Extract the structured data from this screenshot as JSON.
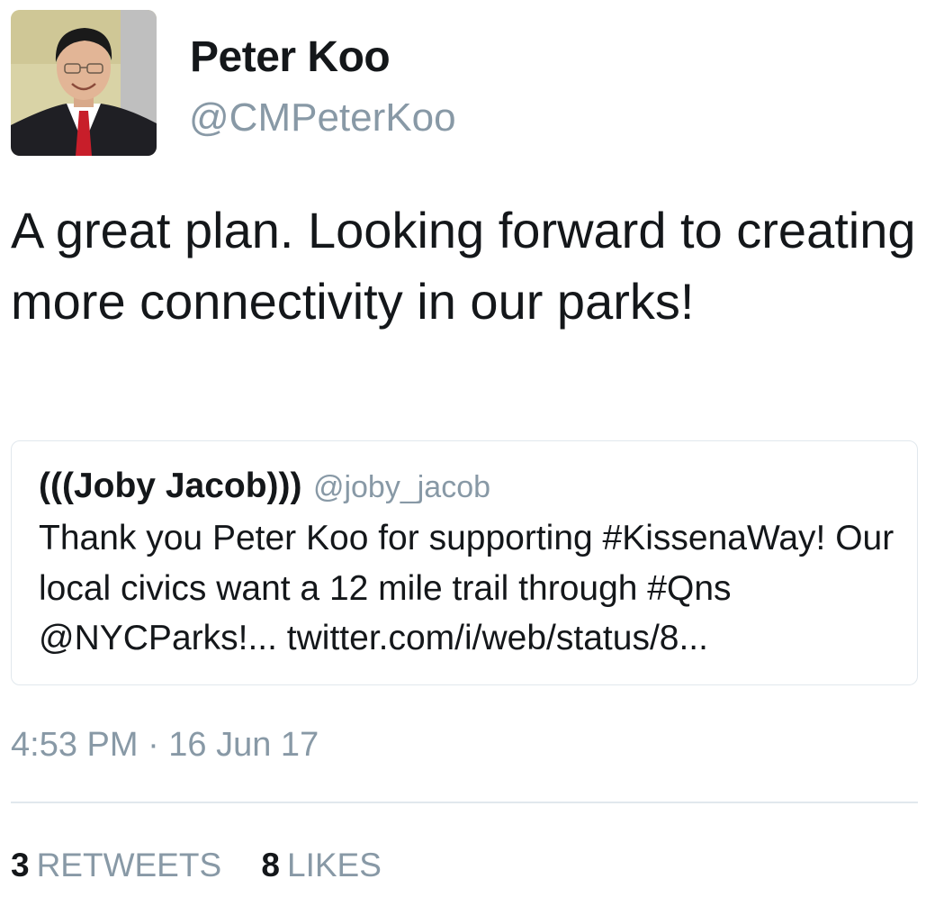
{
  "author": {
    "name": "Peter Koo",
    "handle": "@CMPeterKoo"
  },
  "tweet": {
    "text": "A great plan. Looking forward to creating more connectivity in our parks!"
  },
  "quoted_tweet": {
    "name": "(((Joby Jacob)))",
    "handle": "@joby_jacob",
    "text": "Thank you Peter Koo for supporting #KissenaWay! Our local civics want a 12 mile trail through #Qns @NYCParks!... twitter.com/i/web/status/8..."
  },
  "timestamp": "4:53 PM · 16 Jun 17",
  "stats": {
    "retweets_count": "3",
    "retweets_label": "RETWEETS",
    "likes_count": "8",
    "likes_label": "LIKES"
  },
  "colors": {
    "text": "#14171a",
    "secondary": "#8899a6",
    "border": "#e1e8ed"
  }
}
